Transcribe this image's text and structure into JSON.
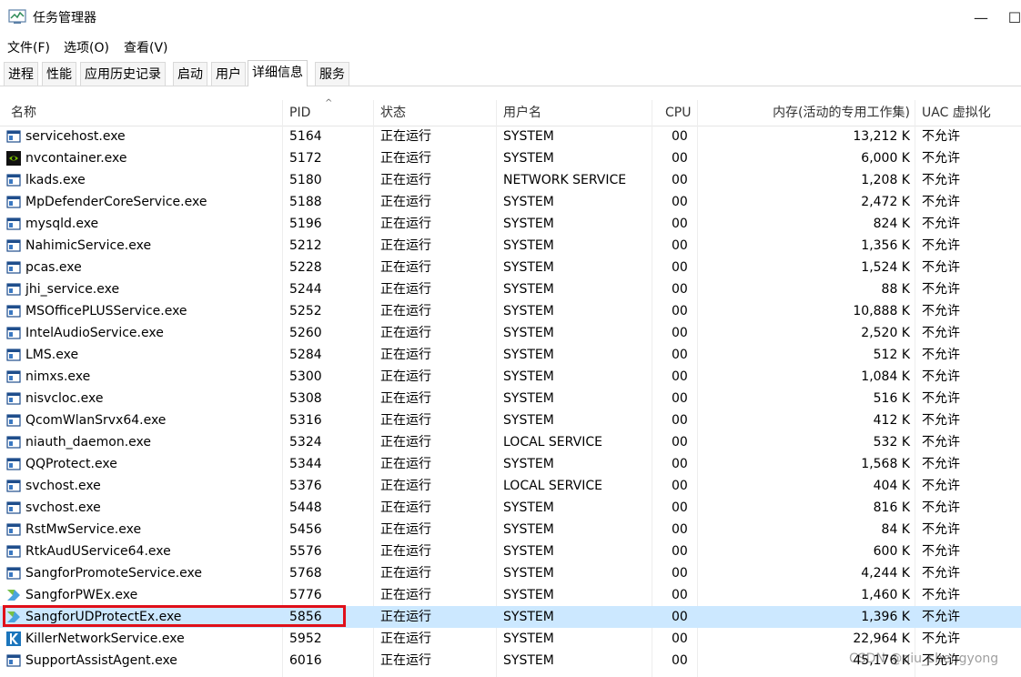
{
  "window": {
    "title": "任务管理器",
    "minimize_glyph": "—",
    "maximize_glyph": "☐",
    "icon": "task-manager-icon"
  },
  "menu": [
    "文件(F)",
    "选项(O)",
    "查看(V)"
  ],
  "tabs": [
    {
      "label": "进程",
      "active": false
    },
    {
      "label": "性能",
      "active": false
    },
    {
      "label": "应用历史记录",
      "active": false
    },
    {
      "label": "启动",
      "active": false
    },
    {
      "label": "用户",
      "active": false
    },
    {
      "label": "详细信息",
      "active": true
    },
    {
      "label": "服务",
      "active": false
    }
  ],
  "columns": {
    "name": "名称",
    "pid": "PID",
    "status": "状态",
    "user": "用户名",
    "cpu": "CPU",
    "memory": "内存(活动的专用工作集)",
    "uac": "UAC 虚拟化"
  },
  "sort_indicator": "^",
  "rows": [
    {
      "icon": "app-window-icon",
      "name": "servicehost.exe",
      "pid": "5164",
      "status": "正在运行",
      "user": "SYSTEM",
      "cpu": "00",
      "memory": "13,212 K",
      "uac": "不允许"
    },
    {
      "icon": "nvidia-icon",
      "name": "nvcontainer.exe",
      "pid": "5172",
      "status": "正在运行",
      "user": "SYSTEM",
      "cpu": "00",
      "memory": "6,000 K",
      "uac": "不允许"
    },
    {
      "icon": "app-window-icon",
      "name": "lkads.exe",
      "pid": "5180",
      "status": "正在运行",
      "user": "NETWORK SERVICE",
      "cpu": "00",
      "memory": "1,208 K",
      "uac": "不允许"
    },
    {
      "icon": "app-window-icon",
      "name": "MpDefenderCoreService.exe",
      "pid": "5188",
      "status": "正在运行",
      "user": "SYSTEM",
      "cpu": "00",
      "memory": "2,472 K",
      "uac": "不允许"
    },
    {
      "icon": "app-window-icon",
      "name": "mysqld.exe",
      "pid": "5196",
      "status": "正在运行",
      "user": "SYSTEM",
      "cpu": "00",
      "memory": "824 K",
      "uac": "不允许"
    },
    {
      "icon": "app-window-icon",
      "name": "NahimicService.exe",
      "pid": "5212",
      "status": "正在运行",
      "user": "SYSTEM",
      "cpu": "00",
      "memory": "1,356 K",
      "uac": "不允许"
    },
    {
      "icon": "app-window-icon",
      "name": "pcas.exe",
      "pid": "5228",
      "status": "正在运行",
      "user": "SYSTEM",
      "cpu": "00",
      "memory": "1,524 K",
      "uac": "不允许"
    },
    {
      "icon": "app-window-icon",
      "name": "jhi_service.exe",
      "pid": "5244",
      "status": "正在运行",
      "user": "SYSTEM",
      "cpu": "00",
      "memory": "88 K",
      "uac": "不允许"
    },
    {
      "icon": "app-window-icon",
      "name": "MSOfficePLUSService.exe",
      "pid": "5252",
      "status": "正在运行",
      "user": "SYSTEM",
      "cpu": "00",
      "memory": "10,888 K",
      "uac": "不允许"
    },
    {
      "icon": "app-window-icon",
      "name": "IntelAudioService.exe",
      "pid": "5260",
      "status": "正在运行",
      "user": "SYSTEM",
      "cpu": "00",
      "memory": "2,520 K",
      "uac": "不允许"
    },
    {
      "icon": "app-window-icon",
      "name": "LMS.exe",
      "pid": "5284",
      "status": "正在运行",
      "user": "SYSTEM",
      "cpu": "00",
      "memory": "512 K",
      "uac": "不允许"
    },
    {
      "icon": "app-window-icon",
      "name": "nimxs.exe",
      "pid": "5300",
      "status": "正在运行",
      "user": "SYSTEM",
      "cpu": "00",
      "memory": "1,084 K",
      "uac": "不允许"
    },
    {
      "icon": "app-window-icon",
      "name": "nisvcloc.exe",
      "pid": "5308",
      "status": "正在运行",
      "user": "SYSTEM",
      "cpu": "00",
      "memory": "516 K",
      "uac": "不允许"
    },
    {
      "icon": "app-window-icon",
      "name": "QcomWlanSrvx64.exe",
      "pid": "5316",
      "status": "正在运行",
      "user": "SYSTEM",
      "cpu": "00",
      "memory": "412 K",
      "uac": "不允许"
    },
    {
      "icon": "app-window-icon",
      "name": "niauth_daemon.exe",
      "pid": "5324",
      "status": "正在运行",
      "user": "LOCAL SERVICE",
      "cpu": "00",
      "memory": "532 K",
      "uac": "不允许"
    },
    {
      "icon": "app-window-icon",
      "name": "QQProtect.exe",
      "pid": "5344",
      "status": "正在运行",
      "user": "SYSTEM",
      "cpu": "00",
      "memory": "1,568 K",
      "uac": "不允许"
    },
    {
      "icon": "app-window-icon",
      "name": "svchost.exe",
      "pid": "5376",
      "status": "正在运行",
      "user": "LOCAL SERVICE",
      "cpu": "00",
      "memory": "404 K",
      "uac": "不允许"
    },
    {
      "icon": "app-window-icon",
      "name": "svchost.exe",
      "pid": "5448",
      "status": "正在运行",
      "user": "SYSTEM",
      "cpu": "00",
      "memory": "816 K",
      "uac": "不允许"
    },
    {
      "icon": "app-window-icon",
      "name": "RstMwService.exe",
      "pid": "5456",
      "status": "正在运行",
      "user": "SYSTEM",
      "cpu": "00",
      "memory": "84 K",
      "uac": "不允许"
    },
    {
      "icon": "app-window-icon",
      "name": "RtkAudUService64.exe",
      "pid": "5576",
      "status": "正在运行",
      "user": "SYSTEM",
      "cpu": "00",
      "memory": "600 K",
      "uac": "不允许"
    },
    {
      "icon": "app-window-icon",
      "name": "SangforPromoteService.exe",
      "pid": "5768",
      "status": "正在运行",
      "user": "SYSTEM",
      "cpu": "00",
      "memory": "4,244 K",
      "uac": "不允许"
    },
    {
      "icon": "sangfor-icon",
      "name": "SangforPWEx.exe",
      "pid": "5776",
      "status": "正在运行",
      "user": "SYSTEM",
      "cpu": "00",
      "memory": "1,460 K",
      "uac": "不允许"
    },
    {
      "icon": "sangfor-icon",
      "name": "SangforUDProtectEx.exe",
      "pid": "5856",
      "status": "正在运行",
      "user": "SYSTEM",
      "cpu": "00",
      "memory": "1,396 K",
      "uac": "不允许",
      "selected": true
    },
    {
      "icon": "killer-icon",
      "name": "KillerNetworkService.exe",
      "pid": "5952",
      "status": "正在运行",
      "user": "SYSTEM",
      "cpu": "00",
      "memory": "22,964 K",
      "uac": "不允许"
    },
    {
      "icon": "app-window-icon",
      "name": "SupportAssistAgent.exe",
      "pid": "6016",
      "status": "正在运行",
      "user": "SYSTEM",
      "cpu": "00",
      "memory": "45,176 K",
      "uac": "不允许"
    }
  ],
  "watermark": "CSDN @qiu_shengyong",
  "colors": {
    "selected_row": "#cce8ff",
    "highlight_border": "#e0101a"
  }
}
